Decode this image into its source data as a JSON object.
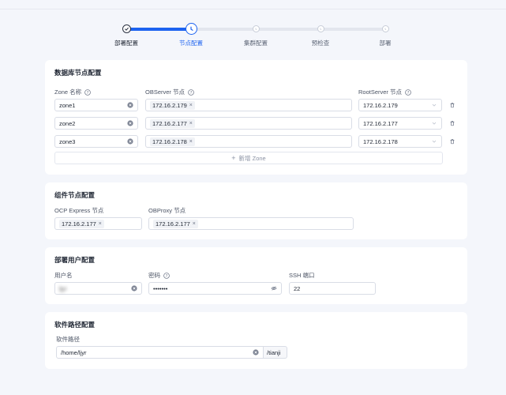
{
  "steps": [
    {
      "label": "部署配置",
      "state": "done"
    },
    {
      "label": "节点配置",
      "state": "active"
    },
    {
      "label": "集群配置",
      "state": "todo"
    },
    {
      "label": "预检查",
      "state": "todo"
    },
    {
      "label": "部署",
      "state": "todo"
    }
  ],
  "db_nodes": {
    "title": "数据库节点配置",
    "zone_label": "Zone 名称",
    "observer_label": "OBServer 节点",
    "rootserver_label": "RootServer 节点",
    "rows": [
      {
        "zone": "zone1",
        "observer": "172.16.2.179",
        "rootserver": "172.16.2.179"
      },
      {
        "zone": "zone2",
        "observer": "172.16.2.177",
        "rootserver": "172.16.2.177"
      },
      {
        "zone": "zone3",
        "observer": "172.16.2.178",
        "rootserver": "172.16.2.178"
      }
    ],
    "add_zone": "新增 Zone"
  },
  "components": {
    "title": "组件节点配置",
    "ocp_label": "OCP Express 节点",
    "ocp_value": "172.16.2.177",
    "obproxy_label": "OBProxy 节点",
    "obproxy_value": "172.16.2.177"
  },
  "deploy_user": {
    "title": "部署用户配置",
    "username_label": "用户名",
    "username_value": "ljyr",
    "password_label": "密码",
    "password_value": "•••••••",
    "ssh_label": "SSH 端口",
    "ssh_value": "22"
  },
  "software_path": {
    "title": "软件路径配置",
    "label": "软件路径",
    "value": "/home/ljyr",
    "suffix": "/tianji"
  },
  "colors": {
    "accent": "#1d63f0",
    "background": "#f4f6fb",
    "card": "#ffffff"
  }
}
